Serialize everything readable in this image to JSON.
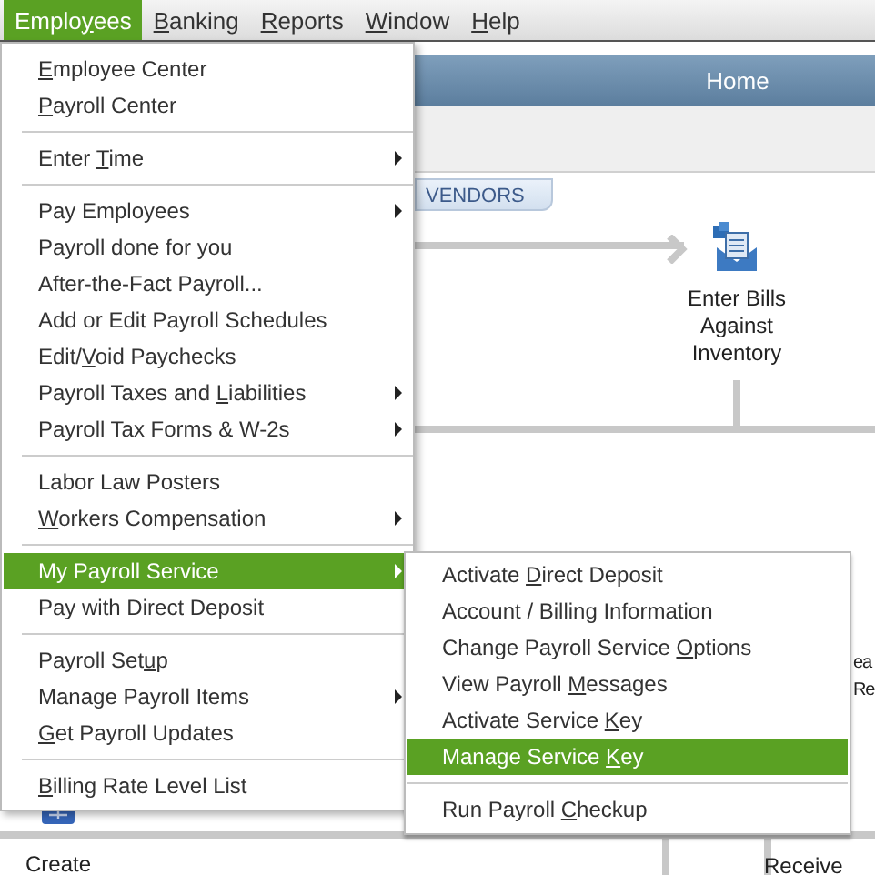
{
  "menubar": [
    {
      "label": {
        "pre": "Emplo",
        "key": "y",
        "post": "ees"
      },
      "selected": true
    },
    {
      "label": {
        "key": "B",
        "post": "anking"
      },
      "selected": false
    },
    {
      "label": {
        "key": "R",
        "post": "eports"
      },
      "selected": false
    },
    {
      "label": {
        "key": "W",
        "post": "indow"
      },
      "selected": false
    },
    {
      "label": {
        "key": "H",
        "post": "elp"
      },
      "selected": false
    }
  ],
  "home": {
    "title": "Home",
    "tab": "VENDORS",
    "node": "Enter Bills Against Inventory",
    "cut_label": [
      "ea",
      "Re"
    ],
    "bottom_labels": [
      "Create",
      "Receive"
    ]
  },
  "menu": {
    "groups": [
      [
        {
          "label": {
            "key": "E",
            "post": "mployee Center"
          },
          "submenu": false,
          "selected": false
        },
        {
          "label": {
            "key": "P",
            "post": "ayroll Center"
          },
          "submenu": false,
          "selected": false
        }
      ],
      [
        {
          "label": {
            "pre": "Enter ",
            "key": "T",
            "post": "ime"
          },
          "submenu": true,
          "selected": false
        }
      ],
      [
        {
          "label": "Pay Employees",
          "submenu": true,
          "selected": false
        },
        {
          "label": "Payroll done for you",
          "submenu": false,
          "selected": false
        },
        {
          "label": "After-the-Fact Payroll...",
          "submenu": false,
          "selected": false
        },
        {
          "label": "Add or Edit Payroll Schedules",
          "submenu": false,
          "selected": false
        },
        {
          "label": {
            "pre": "Edit/",
            "key": "V",
            "post": "oid Paychecks"
          },
          "submenu": false,
          "selected": false
        },
        {
          "label": {
            "pre": "Payroll Taxes and ",
            "key": "L",
            "post": "iabilities"
          },
          "submenu": true,
          "selected": false
        },
        {
          "label": "Payroll Tax Forms & W-2s",
          "submenu": true,
          "selected": false
        }
      ],
      [
        {
          "label": "Labor Law Posters",
          "submenu": false,
          "selected": false
        },
        {
          "label": {
            "key": "W",
            "post": "orkers Compensation"
          },
          "submenu": true,
          "selected": false
        }
      ],
      [
        {
          "label": "My Payroll Service",
          "submenu": true,
          "selected": true
        },
        {
          "label": "Pay with Direct Deposit",
          "submenu": false,
          "selected": false
        }
      ],
      [
        {
          "label": {
            "pre": "Payroll Set",
            "key": "u",
            "post": "p"
          },
          "submenu": false,
          "selected": false
        },
        {
          "label": "Manage Payroll Items",
          "submenu": true,
          "selected": false
        },
        {
          "label": {
            "key": "G",
            "post": "et Payroll Updates"
          },
          "submenu": false,
          "selected": false
        }
      ],
      [
        {
          "label": {
            "key": "B",
            "post": "illing Rate Level List"
          },
          "submenu": false,
          "selected": false
        }
      ]
    ]
  },
  "submenu": {
    "groups": [
      [
        {
          "label": {
            "pre": "Activate ",
            "key": "D",
            "post": "irect Deposit"
          },
          "selected": false
        },
        {
          "label": "Account / Billing Information",
          "selected": false
        },
        {
          "label": {
            "pre": "Change Payroll Service ",
            "key": "O",
            "post": "ptions"
          },
          "selected": false
        },
        {
          "label": {
            "pre": "View Payroll ",
            "key": "M",
            "post": "essages"
          },
          "selected": false
        },
        {
          "label": {
            "pre": "Activate Service ",
            "key": "K",
            "post": "ey"
          },
          "selected": false
        },
        {
          "label": {
            "pre": "Manage Service ",
            "key": "K",
            "post": "ey"
          },
          "selected": true
        }
      ],
      [
        {
          "label": {
            "pre": "Run Payroll ",
            "key": "C",
            "post": "heckup"
          },
          "selected": false
        }
      ]
    ]
  }
}
